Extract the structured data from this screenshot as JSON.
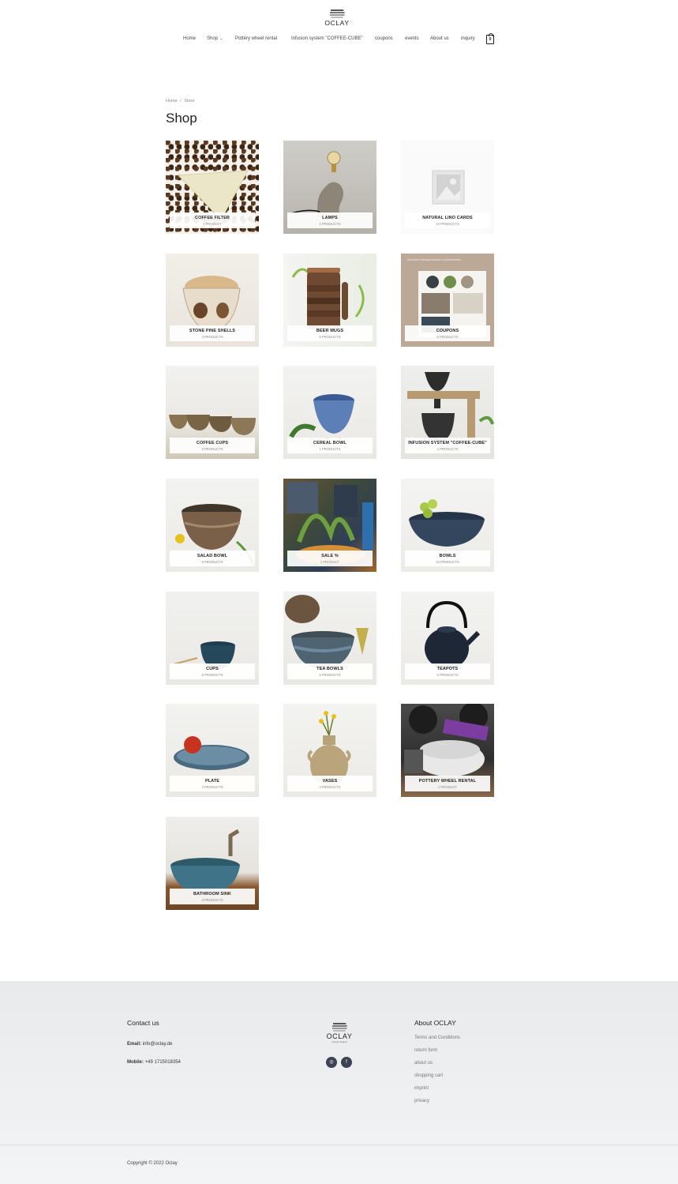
{
  "brand": {
    "name": "OCLAY",
    "tagline": "simply original"
  },
  "nav": {
    "items": [
      {
        "label": "Home"
      },
      {
        "label": "Shop"
      },
      {
        "label": "Pottery wheel rental"
      },
      {
        "label": "Infusion system \"COFFEE-CUBE\""
      },
      {
        "label": "coupons"
      },
      {
        "label": "events"
      },
      {
        "label": "About us"
      },
      {
        "label": "inquiry"
      }
    ],
    "cart_count": "0"
  },
  "breadcrumb": {
    "home": "Home",
    "sep": "/",
    "current": "Store"
  },
  "page_title": "Shop",
  "categories": [
    {
      "name": "COFFEE FILTER",
      "count": "1 PRODUCT",
      "icon": "coffee-filter-photo"
    },
    {
      "name": "LAMPS",
      "count": "2 PRODUCTS",
      "icon": "lamp-photo"
    },
    {
      "name": "NATURAL LINO CARDS",
      "count": "10 PRODUCTS",
      "icon": "placeholder-image-icon"
    },
    {
      "name": "STONE PINE SHELLS",
      "count": "3 PRODUCTS",
      "icon": "pine-shells-photo"
    },
    {
      "name": "BEER MUGS",
      "count": "5 PRODUCTS",
      "icon": "beer-mug-photo"
    },
    {
      "name": "COUPONS",
      "count": "6 PRODUCTS",
      "icon": "coupons-photo"
    },
    {
      "name": "COFFEE CUPS",
      "count": "8 PRODUCTS",
      "icon": "coffee-cups-photo"
    },
    {
      "name": "CEREAL BOWL",
      "count": "1 PRODUCTS",
      "icon": "cereal-bowl-photo"
    },
    {
      "name": "INFUSION SYSTEM \"COFFEE-CUBE\"",
      "count": "4 PRODUCTS",
      "icon": "coffee-cube-photo"
    },
    {
      "name": "SALAD BOWL",
      "count": "5 PRODUCTS",
      "icon": "salad-bowl-photo"
    },
    {
      "name": "SALE %",
      "count": "1 PRODUCT",
      "icon": "sale-photo"
    },
    {
      "name": "BOWLS",
      "count": "10 PRODUCTS",
      "icon": "bowls-photo"
    },
    {
      "name": "CUPS",
      "count": "6 PRODUCTS",
      "icon": "cups-photo"
    },
    {
      "name": "TEA BOWLS",
      "count": "6 PRODUCTS",
      "icon": "tea-bowls-photo"
    },
    {
      "name": "TEAPOTS",
      "count": "2 PRODUCTS",
      "icon": "teapot-photo"
    },
    {
      "name": "PLATE",
      "count": "2 PRODUCTS",
      "icon": "plate-photo"
    },
    {
      "name": "VASES",
      "count": "4 PRODUCTS",
      "icon": "vase-photo"
    },
    {
      "name": "POTTERY WHEEL RENTAL",
      "count": "1 PRODUCT",
      "icon": "pottery-wheel-photo"
    },
    {
      "name": "BATHROOM SINK",
      "count": "3 PRODUCTS",
      "icon": "bathroom-sink-photo"
    }
  ],
  "coupon_banner_text": "Schenken Handgemachtes zu Weihnachten",
  "footer": {
    "contact_title": "Contact us",
    "email_label": "Email:",
    "email_value": "info@oclay.de",
    "mobile_label": "Mobile:",
    "mobile_value": "+49 1715018354",
    "social": [
      {
        "icon": "instagram-icon",
        "glyph": "◎"
      },
      {
        "icon": "facebook-icon",
        "glyph": "f"
      }
    ],
    "about_title": "About OCLAY",
    "links": [
      {
        "label": "Terms and Conditions"
      },
      {
        "label": "return form"
      },
      {
        "label": "about us"
      },
      {
        "label": "shopping cart"
      },
      {
        "label": "imprint"
      },
      {
        "label": "privacy"
      }
    ],
    "copyright": "Copyright © 2022 Oclay"
  }
}
